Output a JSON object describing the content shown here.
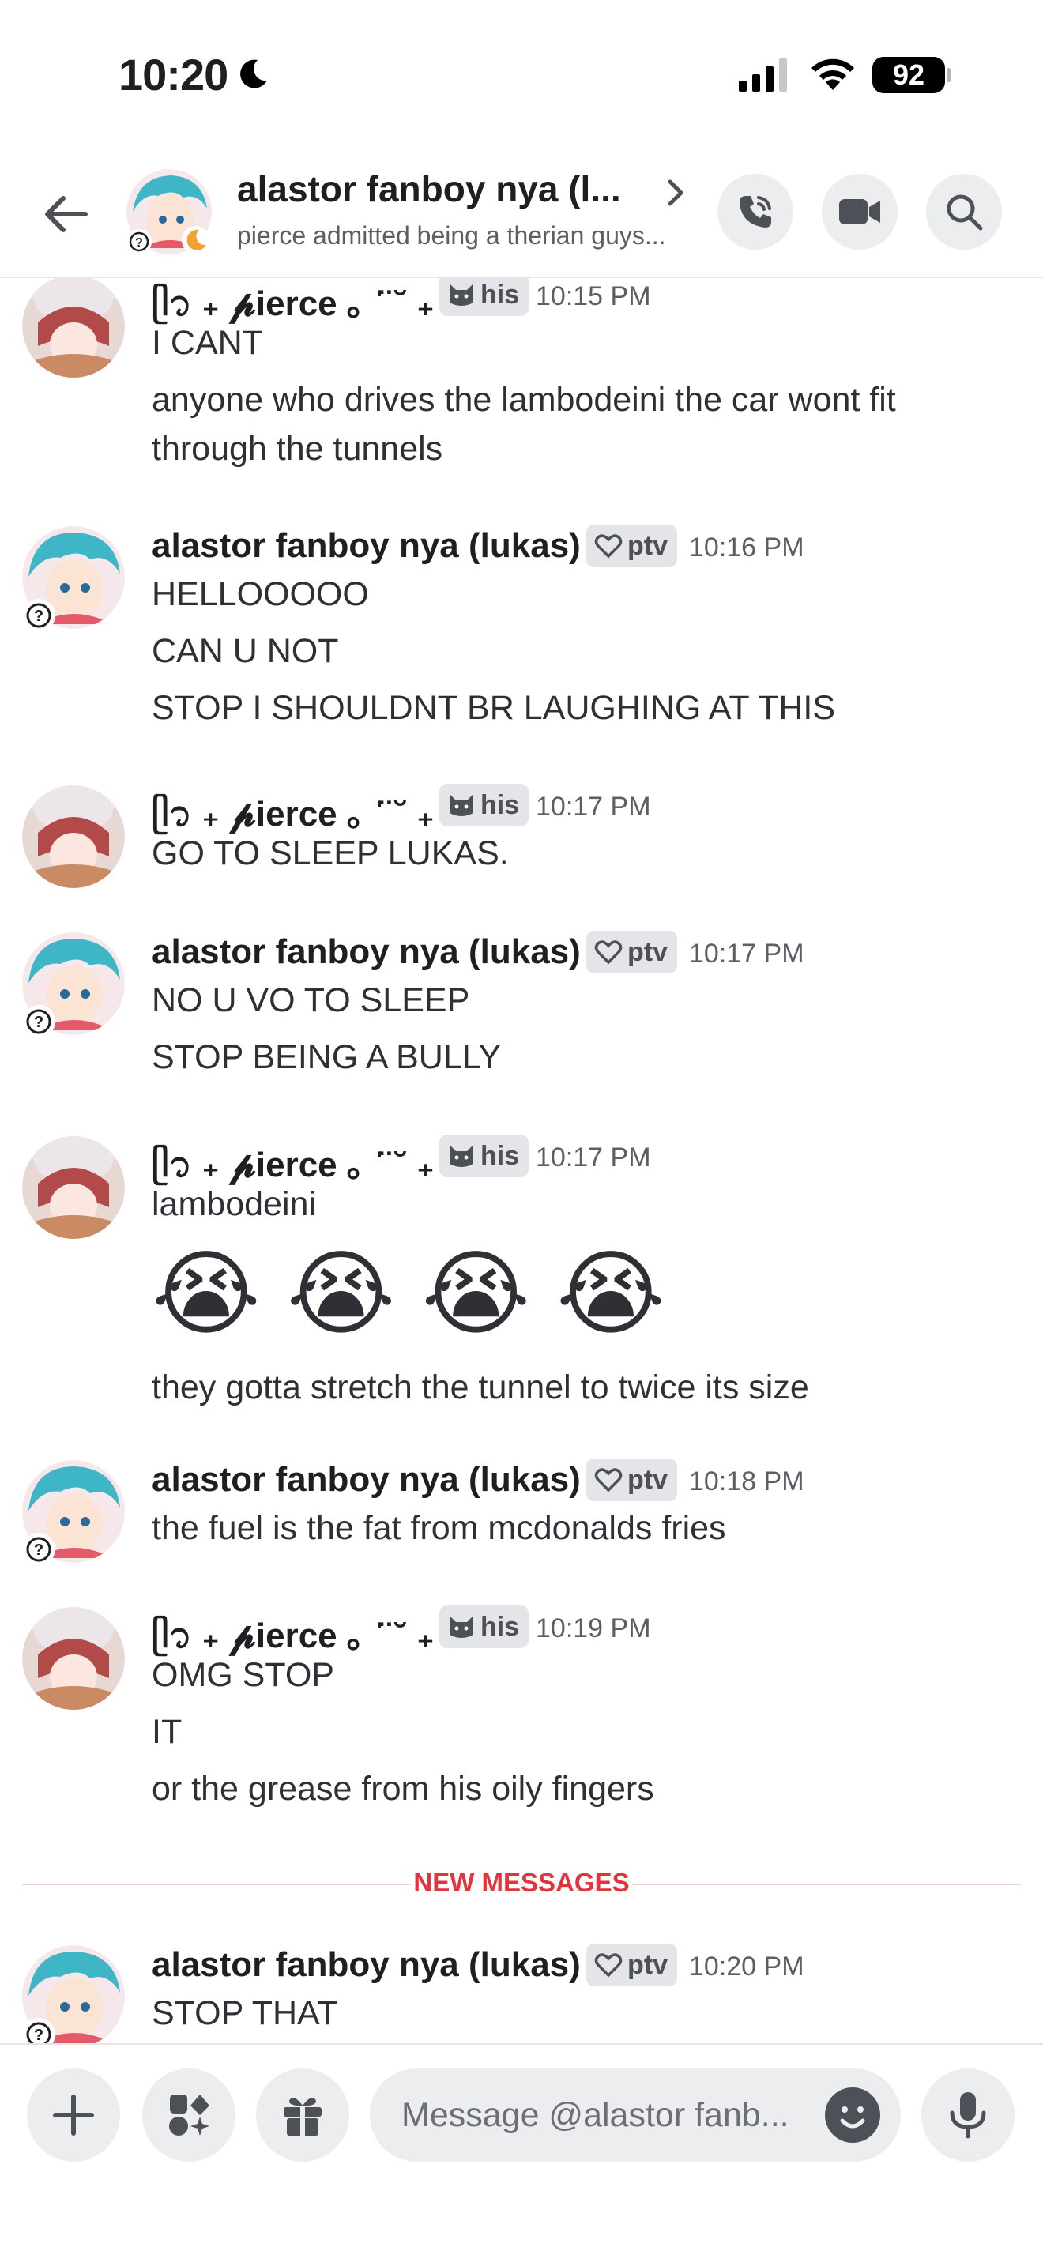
{
  "status_bar": {
    "time": "10:20",
    "battery": "92"
  },
  "header": {
    "title": "alastor fanboy nya (l...",
    "subtitle": "pierce admitted being a therian guys...",
    "icons": [
      "back-arrow-icon",
      "voice-call-icon",
      "video-call-icon",
      "search-icon"
    ]
  },
  "users": {
    "pierce": {
      "name": "ᥫ᭡ ₊ 𝓹ierce ｡ ˈ̈ ˘ ₊",
      "tag": "his"
    },
    "lukas": {
      "name": "alastor fanboy nya (lukas)",
      "tag": "ptv"
    }
  },
  "messages": [
    {
      "user": "pierce",
      "time": "10:15 PM",
      "lines": [
        "I CANT",
        "anyone who drives the lambodeini the car wont fit",
        "through the tunnels"
      ]
    },
    {
      "user": "lukas",
      "time": "10:16 PM",
      "lines": [
        "HELLOOOOO",
        "CAN U NOT",
        "STOP I SHOULDNT BR LAUGHING AT THIS"
      ]
    },
    {
      "user": "pierce",
      "time": "10:17 PM",
      "lines": [
        "GO TO SLEEP LUKAS."
      ]
    },
    {
      "user": "lukas",
      "time": "10:17 PM",
      "lines": [
        "NO U VO TO SLEEP",
        "STOP BEING A BULLY"
      ]
    },
    {
      "user": "pierce",
      "time": "10:17 PM",
      "lines": [
        "lambodeini",
        "😭 😭 😭 😭",
        "they gotta stretch the tunnel to twice its size"
      ]
    },
    {
      "user": "lukas",
      "time": "10:18 PM",
      "lines": [
        "the fuel is the fat from mcdonalds fries"
      ]
    },
    {
      "user": "pierce",
      "time": "10:19 PM",
      "lines": [
        "OMG STOP",
        "IT",
        "or the grease from his oily fingers"
      ]
    },
    {
      "user": "lukas",
      "time": "10:20 PM",
      "lines": [
        "STOP THAT"
      ]
    }
  ],
  "new_messages_label": "NEW MESSAGES",
  "composer": {
    "placeholder": "Message @alastor fanb...",
    "icons": [
      "plus-icon",
      "apps-icon",
      "gift-icon",
      "emoji-icon",
      "microphone-icon"
    ]
  },
  "colors": {
    "accent_red": "#e0353c",
    "tag_bg": "#e3e5e8",
    "button_bg": "#ebedef"
  }
}
